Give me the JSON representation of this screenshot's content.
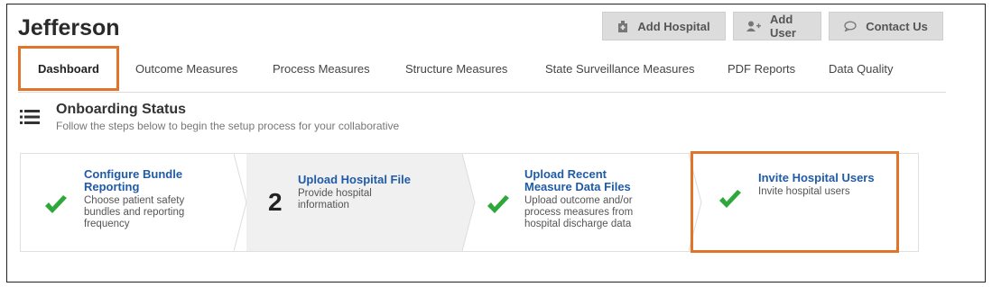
{
  "header": {
    "title": "Jefferson",
    "actions": [
      {
        "label": "Add Hospital",
        "icon": "hospital-icon"
      },
      {
        "label": "Add User",
        "icon": "add-user-icon"
      },
      {
        "label": "Contact Us",
        "icon": "chat-bubble-icon"
      }
    ]
  },
  "nav": {
    "tabs": [
      {
        "label": "Dashboard",
        "active": true
      },
      {
        "label": "Outcome Measures"
      },
      {
        "label": "Process Measures"
      },
      {
        "label": "Structure Measures"
      },
      {
        "label": "State Surveillance Measures"
      },
      {
        "label": "PDF Reports"
      },
      {
        "label": "Data Quality"
      }
    ]
  },
  "onboarding": {
    "title": "Onboarding Status",
    "subtitle": "Follow the steps below to begin the setup process for your collaborative",
    "steps": [
      {
        "title": "Configure Bundle Reporting",
        "description": "Choose patient safety bundles and reporting frequency",
        "status": "complete"
      },
      {
        "title": "Upload Hospital File",
        "description": "Provide hospital information",
        "status": "current",
        "number": "2"
      },
      {
        "title": "Upload Recent Measure Data Files",
        "description": "Upload outcome and/or process measures from hospital discharge data",
        "status": "complete"
      },
      {
        "title": "Invite Hospital Users",
        "description": "Invite hospital users",
        "status": "complete"
      }
    ]
  },
  "colors": {
    "accent_orange": "#e07428",
    "link_blue": "#1f5ba6",
    "check_green": "#2ea83a"
  }
}
